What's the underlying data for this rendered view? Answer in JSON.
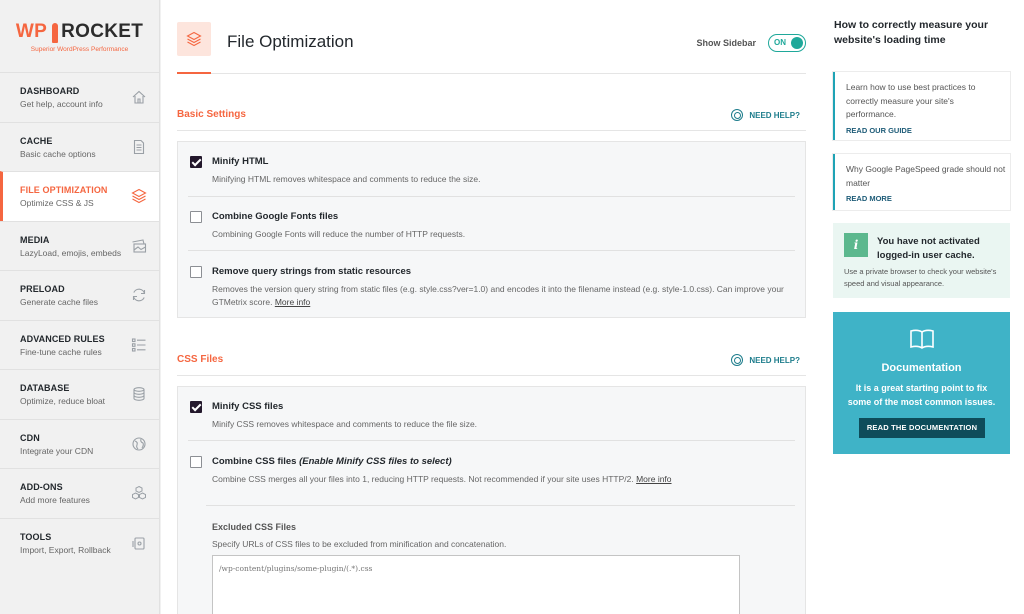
{
  "brand": {
    "name_prefix": "WP",
    "name_suffix": "ROCKET",
    "tagline": "Superior WordPress Performance"
  },
  "sidebar": {
    "items": [
      {
        "title": "DASHBOARD",
        "subtitle": "Get help, account info",
        "icon": "home-icon"
      },
      {
        "title": "CACHE",
        "subtitle": "Basic cache options",
        "icon": "document-icon"
      },
      {
        "title": "FILE OPTIMIZATION",
        "subtitle": "Optimize CSS & JS",
        "icon": "layers-icon",
        "active": true
      },
      {
        "title": "MEDIA",
        "subtitle": "LazyLoad, emojis, embeds",
        "icon": "image-icon"
      },
      {
        "title": "PRELOAD",
        "subtitle": "Generate cache files",
        "icon": "refresh-icon"
      },
      {
        "title": "ADVANCED RULES",
        "subtitle": "Fine-tune cache rules",
        "icon": "list-icon"
      },
      {
        "title": "DATABASE",
        "subtitle": "Optimize, reduce bloat",
        "icon": "database-icon"
      },
      {
        "title": "CDN",
        "subtitle": "Integrate your CDN",
        "icon": "globe-icon"
      },
      {
        "title": "ADD-ONS",
        "subtitle": "Add more features",
        "icon": "cubes-icon"
      },
      {
        "title": "TOOLS",
        "subtitle": "Import, Export, Rollback",
        "icon": "tools-icon"
      }
    ]
  },
  "header": {
    "title": "File Optimization",
    "show_sidebar_label": "Show Sidebar",
    "toggle_label": "ON",
    "toggle_on": true
  },
  "basic": {
    "title": "Basic Settings",
    "need_help": "NEED HELP?",
    "options": [
      {
        "title": "Minify HTML",
        "desc": "Minifying HTML removes whitespace and comments to reduce the size.",
        "checked": true
      },
      {
        "title": "Combine Google Fonts files",
        "desc": "Combining Google Fonts will reduce the number of HTTP requests.",
        "checked": false
      },
      {
        "title": "Remove query strings from static resources",
        "desc": "Removes the version query string from static files (e.g. style.css?ver=1.0) and encodes it into the filename instead (e.g. style-1.0.css). Can improve your GTMetrix score.",
        "link": "More info",
        "checked": false
      }
    ]
  },
  "css": {
    "title": "CSS Files",
    "need_help": "NEED HELP?",
    "options": [
      {
        "title": "Minify CSS files",
        "desc": "Minify CSS removes whitespace and comments to reduce the file size.",
        "checked": true
      },
      {
        "title": "Combine CSS files",
        "title_em": "(Enable Minify CSS files to select)",
        "desc": "Combine CSS merges all your files into 1, reducing HTTP requests. Not recommended if your site uses HTTP/2.",
        "link": "More info",
        "checked": false
      }
    ],
    "excluded": {
      "title": "Excluded CSS Files",
      "desc": "Specify URLs of CSS files to be excluded from minification and concatenation.",
      "placeholder": "/wp-content/plugins/some-plugin/(.*).css"
    }
  },
  "right": {
    "title": "How to correctly measure your website's loading time",
    "cards": [
      {
        "text": "Learn how to use best practices to correctly measure your site's performance.",
        "link": "READ OUR GUIDE"
      },
      {
        "text": "Why Google PageSpeed grade should not matter",
        "link": "READ MORE"
      }
    ],
    "notice": {
      "icon": "i",
      "title": "You have not activated logged-in user cache.",
      "desc": "Use a private browser to check your website's speed and visual appearance."
    },
    "doc": {
      "title": "Documentation",
      "desc": "It is a great starting point to fix some of the most common issues.",
      "button": "READ THE DOCUMENTATION"
    }
  },
  "colors": {
    "accent": "#f56640",
    "teal": "#1fa89a",
    "doc_bg": "#3fb3c7",
    "doc_button": "#0e4c5a",
    "notice_bg": "#eaf6f2",
    "notice_icon": "#5cb88e"
  }
}
